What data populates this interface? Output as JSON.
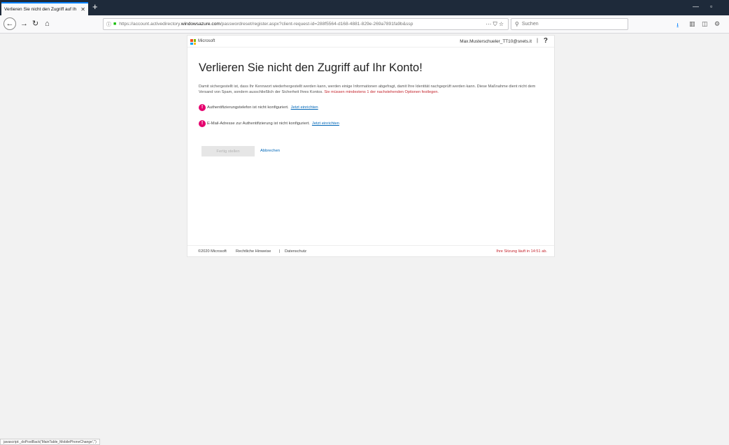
{
  "browser": {
    "tab_title": "Verlieren Sie nicht den Zugriff auf Ih",
    "tab_close": "✕",
    "new_tab": "+",
    "url_host_prefix": "https://account.activedirectory.",
    "url_host_bold": "windowsazure.com",
    "url_path": "/passwordreset/register.aspx?client-request-id=288f5564-d168-4881-829e-269a7891fa9b&ssp",
    "url_actions": "··· ⛉ ☆",
    "search_placeholder": "Suchen",
    "status_bar": "javascript:_doPostBack('MainTable_MobilePhoneChange','')"
  },
  "header": {
    "brand": "Microsoft",
    "user_email": "Max.Musterschueler_TT10@snets.it",
    "separator": "|",
    "help": "?"
  },
  "main": {
    "title": "Verlieren Sie nicht den Zugriff auf Ihr Konto!",
    "description": "Damit sichergestellt ist, dass Ihr Kennwort wiederhergestellt werden kann, werden einige Informationen abgefragt, damit Ihre Identität nachgeprüft werden kann. Diese Maßnahme dient nicht dem Versand von Spam, sondern ausschließlich der Sicherheit Ihres Kontos.",
    "description_required": "Sie müssen mindestens 1 der nachstehenden Optionen festlegen.",
    "phone_alert": "Authentifizierungstelefon ist nicht konfiguriert.",
    "phone_link": "Jetzt einrichten",
    "email_alert": "E-Mail-Adresse zur Authentifizierung ist nicht konfiguriert.",
    "email_link": "Jetzt einrichten",
    "done_button": "Fertig stellen",
    "cancel_link": "Abbrechen"
  },
  "footer": {
    "copyright": "©2020 Microsoft",
    "legal": "Rechtliche Hinweise",
    "separator": "|",
    "privacy": "Datenschutz",
    "session": "Ihre Sitzung läuft in 14:51 ab."
  },
  "colors": {
    "accent_link": "#0067b8",
    "required_red": "#c4262e",
    "alert_pink": "#e5006e",
    "titlebar": "#1e2a3a"
  }
}
